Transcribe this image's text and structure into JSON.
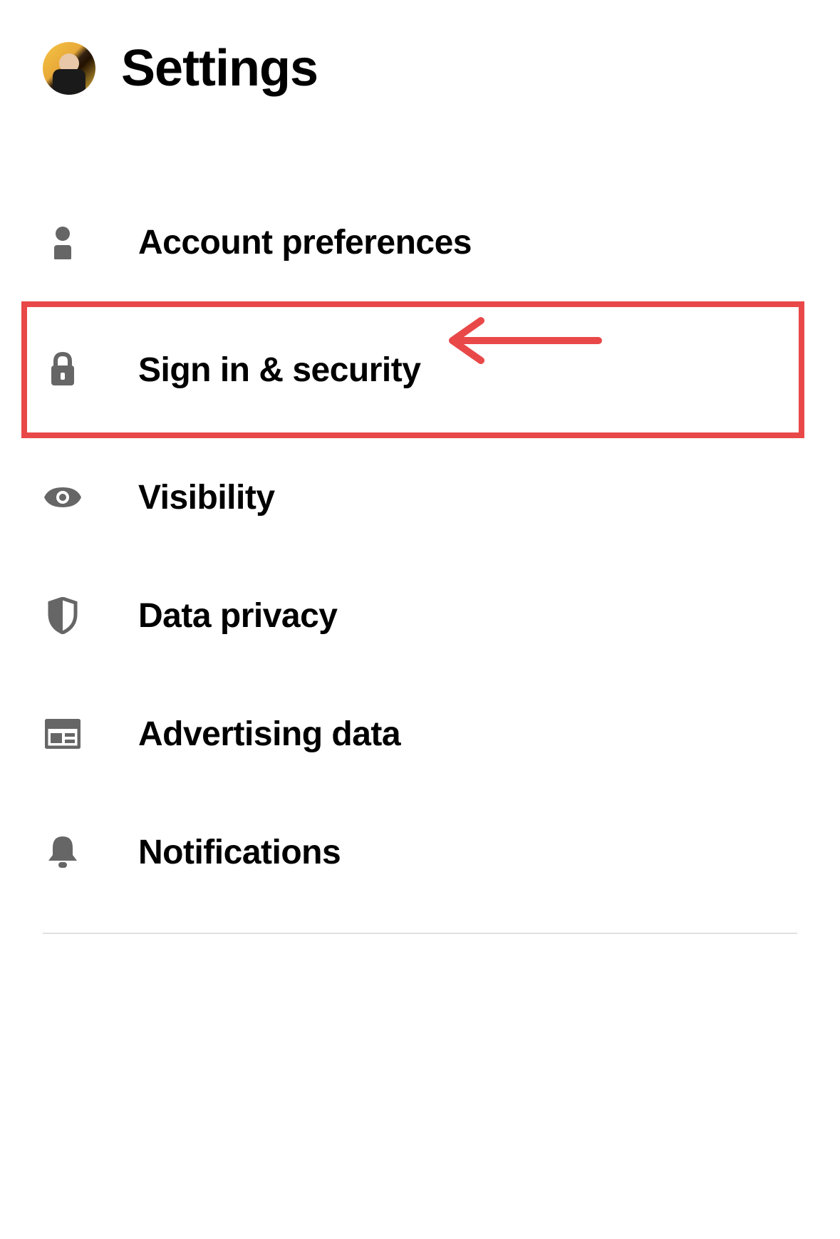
{
  "header": {
    "title": "Settings"
  },
  "menu": {
    "items": [
      {
        "label": "Account preferences",
        "icon": "person-icon"
      },
      {
        "label": "Sign in & security",
        "icon": "lock-icon"
      },
      {
        "label": "Visibility",
        "icon": "eye-icon"
      },
      {
        "label": "Data privacy",
        "icon": "shield-icon"
      },
      {
        "label": "Advertising data",
        "icon": "newspaper-icon"
      },
      {
        "label": "Notifications",
        "icon": "bell-icon"
      }
    ],
    "highlighted_index": 1
  },
  "colors": {
    "highlight": "#e94849",
    "icon": "#666666",
    "text": "#000000"
  }
}
